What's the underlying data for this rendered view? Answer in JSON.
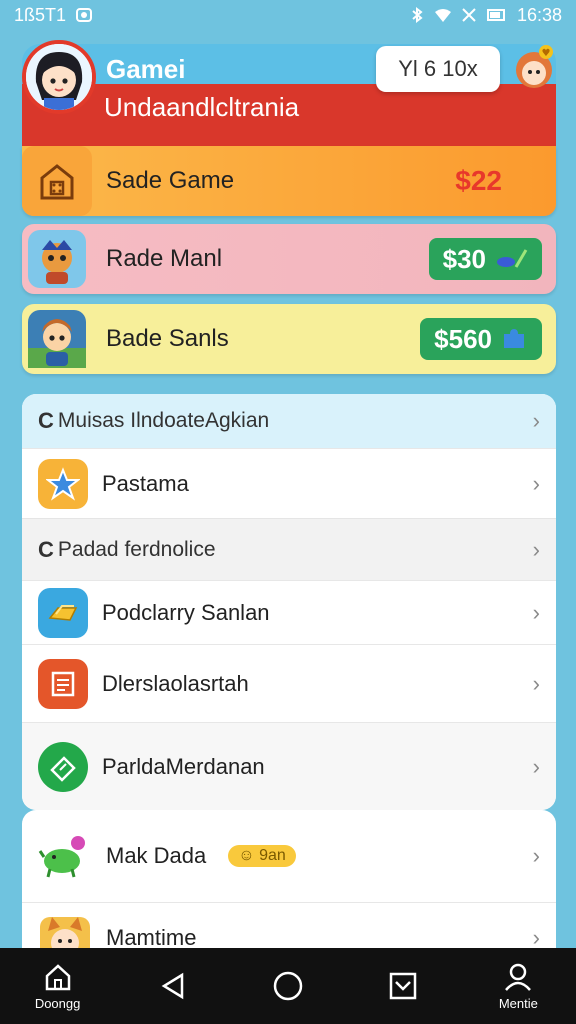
{
  "status_bar": {
    "left_text": "1ß5T1",
    "time": "16:38"
  },
  "header": {
    "title": "Gamei",
    "subtitle": "Undaandlcltrania",
    "multiplier": "Yl 6 10x"
  },
  "game_rows": [
    {
      "label": "Sade Game",
      "price": "$22",
      "style": "plain",
      "icon": "shop-icon"
    },
    {
      "label": "Rade Manl",
      "price": "$30",
      "style": "pill",
      "icon": "character-icon"
    },
    {
      "label": "Bade Sanls",
      "price": "$560",
      "style": "pill",
      "icon": "character-icon"
    }
  ],
  "menu": {
    "sections": [
      {
        "label": "Muisas IlndoateАgkian"
      },
      {
        "label": "Padad ferdnolice"
      }
    ],
    "items": [
      {
        "label": "Pastama",
        "icon": "star-icon"
      },
      {
        "label": "Podclarry Sanlan",
        "icon": "gold-icon"
      },
      {
        "label": "Dlerslaolasrtah",
        "icon": "document-icon"
      },
      {
        "label": "ParldaМerdanan",
        "icon": "ticket-icon"
      },
      {
        "label": "Mak Dada",
        "icon": "dragon-icon",
        "badge": "☺ 9an"
      },
      {
        "label": "Mamtime",
        "icon": "cat-icon"
      }
    ]
  },
  "nav": {
    "home_label": "Doongg",
    "profile_label": "Mentie"
  },
  "colors": {
    "background": "#6fc3df",
    "header_red": "#d9372b",
    "accent_green": "#2aa35b"
  }
}
